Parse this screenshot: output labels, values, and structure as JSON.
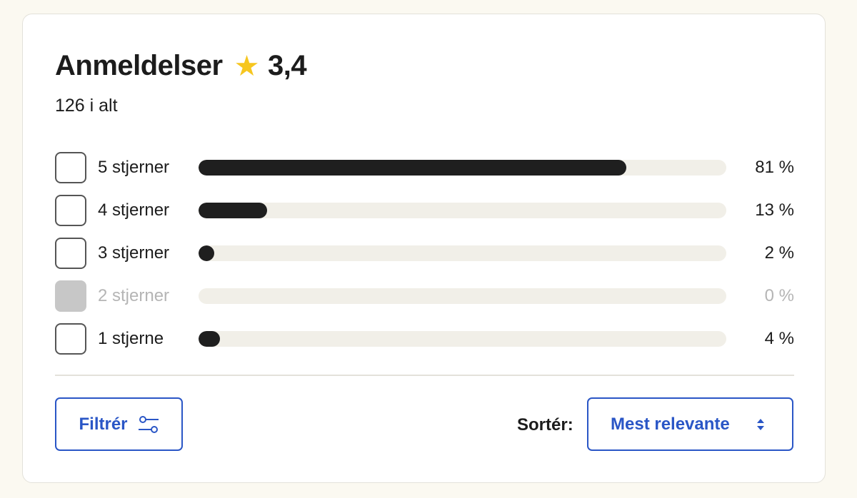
{
  "reviews": {
    "title": "Anmeldelser",
    "rating": "3,4",
    "star_icon": "star-icon",
    "total": "126 i alt",
    "colors": {
      "star": "#f6c61f",
      "bar": "#1f1f1f",
      "track": "#f1efe8",
      "accent": "#2a56c6"
    },
    "rows": [
      {
        "label": "5 stjerner",
        "percent_text": "81 %",
        "fraction": 0.81,
        "enabled": true
      },
      {
        "label": "4 stjerner",
        "percent_text": "13 %",
        "fraction": 0.13,
        "enabled": true
      },
      {
        "label": "3 stjerner",
        "percent_text": "2 %",
        "fraction": 0.02,
        "enabled": true
      },
      {
        "label": "2 stjerner",
        "percent_text": "0 %",
        "fraction": 0.0,
        "enabled": false
      },
      {
        "label": "1 stjerne",
        "percent_text": "4 %",
        "fraction": 0.04,
        "enabled": true
      }
    ]
  },
  "controls": {
    "filter_label": "Filtrér",
    "filter_icon": "sliders-icon",
    "sort_label": "Sortér:",
    "sort_value": "Mest relevante",
    "sort_icon": "sort-arrows-icon"
  }
}
